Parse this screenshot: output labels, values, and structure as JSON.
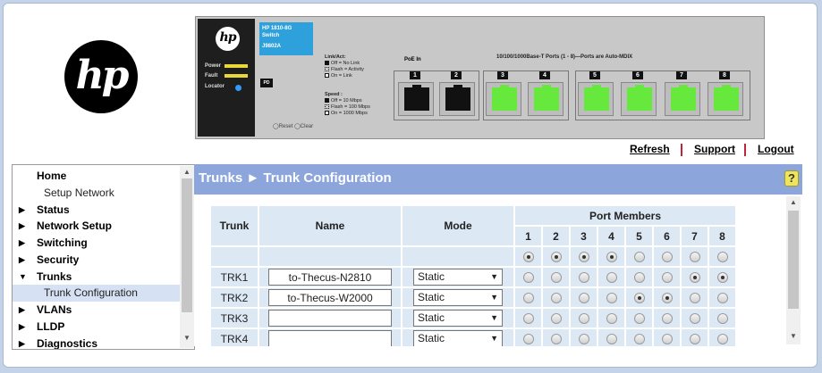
{
  "logo_text": "hp",
  "switch": {
    "model_line1": "HP 1810-8G",
    "model_line2": "Switch",
    "model_number": "J9802A",
    "indicators": [
      "Power",
      "Fault",
      "Locator"
    ],
    "pd_label": "PD",
    "reset_label": "Reset",
    "clear_label": "Clear",
    "link_act_title": "Link/Act:",
    "link_act": [
      "Off = No Link",
      "Flash = Activity",
      "On = Link"
    ],
    "speed_title": "Speed :",
    "speed": [
      "Off = 10 Mbps",
      "Flash = 100 Mbps",
      "On = 1000 Mbps"
    ],
    "poe_label": "PoE In",
    "ports_label": "10/100/1000Base-T Ports (1 - 8)—Ports are Auto-MDIX",
    "ports": [
      {
        "num": "1",
        "state": "black"
      },
      {
        "num": "2",
        "state": "black"
      },
      {
        "num": "3",
        "state": "green"
      },
      {
        "num": "4",
        "state": "green"
      },
      {
        "num": "5",
        "state": "green"
      },
      {
        "num": "6",
        "state": "green"
      },
      {
        "num": "7",
        "state": "green"
      },
      {
        "num": "8",
        "state": "green"
      }
    ]
  },
  "top_links": {
    "refresh": "Refresh",
    "support": "Support",
    "logout": "Logout"
  },
  "sidebar": {
    "items": [
      {
        "label": "Home",
        "type": "top"
      },
      {
        "label": "Setup Network",
        "type": "sub"
      },
      {
        "label": "Status",
        "type": "collapsed"
      },
      {
        "label": "Network Setup",
        "type": "collapsed"
      },
      {
        "label": "Switching",
        "type": "collapsed"
      },
      {
        "label": "Security",
        "type": "collapsed"
      },
      {
        "label": "Trunks",
        "type": "expanded"
      },
      {
        "label": "Trunk Configuration",
        "type": "sub-active"
      },
      {
        "label": "VLANs",
        "type": "collapsed"
      },
      {
        "label": "LLDP",
        "type": "collapsed"
      },
      {
        "label": "Diagnostics",
        "type": "collapsed"
      }
    ]
  },
  "page_title": "Trunks ► Trunk Configuration",
  "help_icon": "?",
  "table": {
    "headers": {
      "trunk": "Trunk",
      "name": "Name",
      "mode": "Mode",
      "port_members": "Port Members"
    },
    "port_numbers": [
      "1",
      "2",
      "3",
      "4",
      "5",
      "6",
      "7",
      "8"
    ],
    "bulk_row": [
      true,
      true,
      true,
      true,
      false,
      false,
      false,
      false
    ],
    "rows": [
      {
        "trunk": "TRK1",
        "name": "to-Thecus-N2810",
        "mode": "Static",
        "ports": [
          false,
          false,
          false,
          false,
          false,
          false,
          true,
          true
        ]
      },
      {
        "trunk": "TRK2",
        "name": "to-Thecus-W2000",
        "mode": "Static",
        "ports": [
          false,
          false,
          false,
          false,
          true,
          true,
          false,
          false
        ]
      },
      {
        "trunk": "TRK3",
        "name": "",
        "mode": "Static",
        "ports": [
          false,
          false,
          false,
          false,
          false,
          false,
          false,
          false
        ]
      },
      {
        "trunk": "TRK4",
        "name": "",
        "mode": "Static",
        "ports": [
          false,
          false,
          false,
          false,
          false,
          false,
          false,
          false
        ]
      }
    ]
  }
}
